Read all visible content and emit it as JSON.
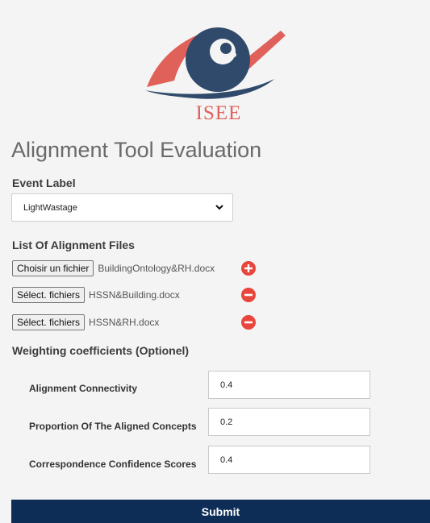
{
  "logo": {
    "text": "ISEE"
  },
  "title": "Alignment Tool Evaluation",
  "event": {
    "label": "Event Label",
    "selected": "LightWastage"
  },
  "files": {
    "label": "List Of Alignment Files",
    "rows": [
      {
        "button": "Choisir un fichier",
        "name": "BuildingOntology&RH.docx",
        "action": "add-icon"
      },
      {
        "button": "Sélect. fichiers",
        "name": "HSSN&Building.docx",
        "action": "remove-icon"
      },
      {
        "button": "Sélect. fichiers",
        "name": "HSSN&RH.docx",
        "action": "remove-icon"
      }
    ]
  },
  "weights": {
    "label": "Weighting coefficients (Optionel)",
    "rows": [
      {
        "label": "Alignment Connectivity",
        "value": "0.4"
      },
      {
        "label": "Proportion Of The Aligned Concepts",
        "value": "0.2"
      },
      {
        "label": "Correspondence Confidence Scores",
        "value": "0.4"
      }
    ]
  },
  "submit_label": "Submit",
  "colors": {
    "brand_navy": "#0d2d57",
    "brand_coral": "#e0605a",
    "eye_blue": "#2f4a6a",
    "add_remove_red": "#e8463d"
  }
}
